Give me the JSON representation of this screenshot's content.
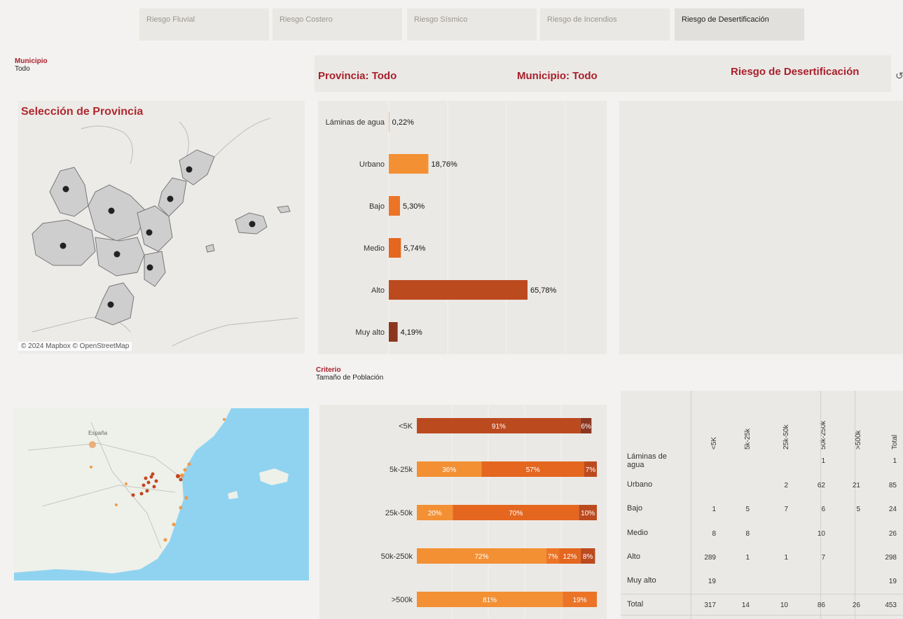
{
  "tabs": [
    {
      "label": "Riesgo Fluvial",
      "active": false
    },
    {
      "label": "Riesgo Costero",
      "active": false
    },
    {
      "label": "Riesgo Sísmico",
      "active": false
    },
    {
      "label": "Riesgo de Incendios",
      "active": false
    },
    {
      "label": "Riesgo de Desertificación",
      "active": true
    }
  ],
  "filters": {
    "municipio": {
      "title": "Municipio",
      "value": "Todo"
    },
    "criterio": {
      "title": "Criterio",
      "value": "Tamaño de Población"
    }
  },
  "header": {
    "provincia": "Provincia: Todo",
    "municipio": "Municipio: Todo",
    "riesgo": "Riesgo de Desertificación"
  },
  "map1": {
    "title": "Selección de Provincia",
    "attribution": "© 2024 Mapbox © OpenStreetMap"
  },
  "map2": {
    "label_espana": "España"
  },
  "colors": {
    "laminas": "#f4a06a",
    "urbano": "#f39033",
    "bajo": "#ec7427",
    "medio": "#e4661f",
    "alto": "#bc4a1f",
    "muy_alto": "#8b3720",
    "accent": "#a81f2c"
  },
  "chart_data": [
    {
      "type": "bar",
      "orientation": "horizontal",
      "categories": [
        "Láminas de agua",
        "Urbano",
        "Bajo",
        "Medio",
        "Alto",
        "Muy alto"
      ],
      "values": [
        0.22,
        18.76,
        5.3,
        5.74,
        65.78,
        4.19
      ],
      "labels": [
        "0,22%",
        "18,76%",
        "5,30%",
        "5,74%",
        "65,78%",
        "4,19%"
      ],
      "xlim": [
        0,
        100
      ]
    },
    {
      "type": "bar",
      "orientation": "horizontal",
      "stacked": true,
      "categories": [
        "<5K",
        "5k-25k",
        "25k-50k",
        "50k-250k",
        ">500k"
      ],
      "rows": [
        [
          {
            "cls": "alto",
            "value": 91,
            "label": "91%"
          },
          {
            "cls": "muy_alto",
            "value": 6,
            "label": "6%"
          }
        ],
        [
          {
            "cls": "urbano",
            "value": 36,
            "label": "36%"
          },
          {
            "cls": "medio",
            "value": 57,
            "label": "57%"
          },
          {
            "cls": "alto",
            "value": 7,
            "label": "7%"
          }
        ],
        [
          {
            "cls": "urbano",
            "value": 20,
            "label": "20%"
          },
          {
            "cls": "medio",
            "value": 70,
            "label": "70%"
          },
          {
            "cls": "alto",
            "value": 10,
            "label": "10%"
          }
        ],
        [
          {
            "cls": "urbano",
            "value": 72,
            "label": "72%"
          },
          {
            "cls": "bajo",
            "value": 7,
            "label": "7%"
          },
          {
            "cls": "medio",
            "value": 12,
            "label": "12%"
          },
          {
            "cls": "alto",
            "value": 8,
            "label": "8%"
          }
        ],
        [
          {
            "cls": "urbano",
            "value": 81,
            "label": "81%"
          },
          {
            "cls": "bajo",
            "value": 19,
            "label": "19%"
          }
        ]
      ],
      "xlim": [
        0,
        100
      ]
    }
  ],
  "crosstab": {
    "columns": [
      "<5K",
      "5k-25k",
      "25k-50k",
      "50k-250k",
      ">500k",
      "Total"
    ],
    "rows": [
      {
        "label": "Láminas de agua",
        "cells": [
          "",
          "",
          "",
          "1",
          "",
          "1"
        ]
      },
      {
        "label": "Urbano",
        "cells": [
          "",
          "",
          "2",
          "62",
          "21",
          "85"
        ]
      },
      {
        "label": "Bajo",
        "cells": [
          "1",
          "5",
          "7",
          "6",
          "5",
          "24"
        ]
      },
      {
        "label": "Medio",
        "cells": [
          "8",
          "8",
          "",
          "10",
          "",
          "26"
        ]
      },
      {
        "label": "Alto",
        "cells": [
          "289",
          "1",
          "1",
          "7",
          "",
          "298"
        ]
      },
      {
        "label": "Muy alto",
        "cells": [
          "19",
          "",
          "",
          "",
          "",
          "19"
        ]
      },
      {
        "label": "Total",
        "cells": [
          "317",
          "14",
          "10",
          "86",
          "26",
          "453"
        ]
      }
    ]
  }
}
